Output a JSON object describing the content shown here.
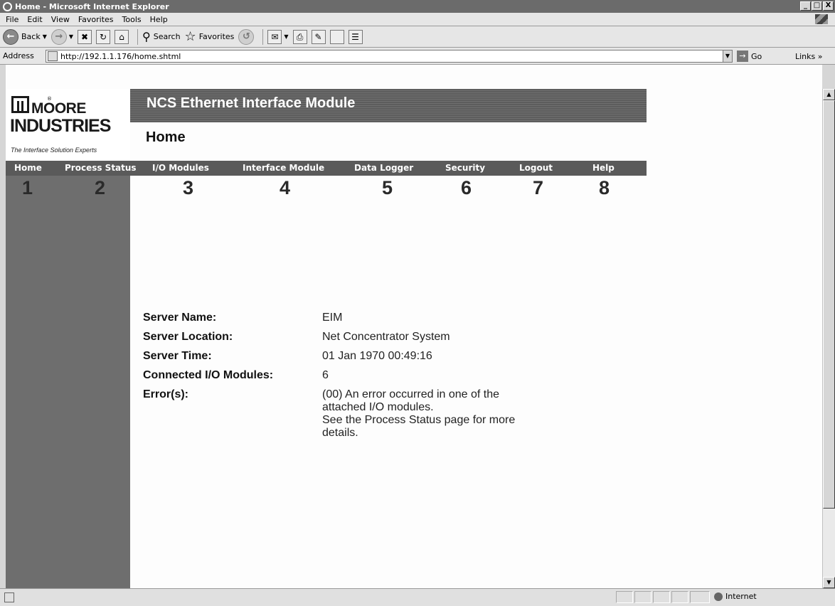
{
  "window": {
    "title": "Home - Microsoft Internet Explorer",
    "minimize": "_",
    "maximize": "□",
    "close": "X"
  },
  "menu": {
    "items": [
      "File",
      "Edit",
      "View",
      "Favorites",
      "Tools",
      "Help"
    ]
  },
  "toolbar": {
    "back_label": "Back",
    "search_label": "Search",
    "favorites_label": "Favorites"
  },
  "addressbar": {
    "label": "Address",
    "url": "http://192.1.1.176/home.shtml",
    "go_label": "Go",
    "links_label": "Links"
  },
  "statusbar": {
    "zone": "Internet"
  },
  "page": {
    "logo": {
      "line1": "MOORE",
      "line2": "INDUSTRIES",
      "tagline": "The Interface Solution Experts",
      "registered": "®"
    },
    "banner_title": "NCS Ethernet Interface Module",
    "heading": "Home",
    "nav": [
      {
        "label": "Home",
        "number": "1"
      },
      {
        "label": "Process Status",
        "number": "2"
      },
      {
        "label": "I/O Modules",
        "number": "3"
      },
      {
        "label": "Interface Module",
        "number": "4"
      },
      {
        "label": "Data Logger",
        "number": "5"
      },
      {
        "label": "Security",
        "number": "6"
      },
      {
        "label": "Logout",
        "number": "7"
      },
      {
        "label": "Help",
        "number": "8"
      }
    ],
    "info": [
      {
        "label": "Server Name:",
        "value": "EIM"
      },
      {
        "label": "Server Location:",
        "value": "Net Concentrator System"
      },
      {
        "label": "Server Time:",
        "value": "01 Jan 1970 00:49:16"
      },
      {
        "label": "Connected I/O Modules:",
        "value": "6"
      },
      {
        "label": "Error(s):",
        "value_lines": [
          "(00) An error occurred in one of the",
          "attached I/O modules.",
          "See the Process Status page for more",
          "details."
        ]
      }
    ]
  }
}
